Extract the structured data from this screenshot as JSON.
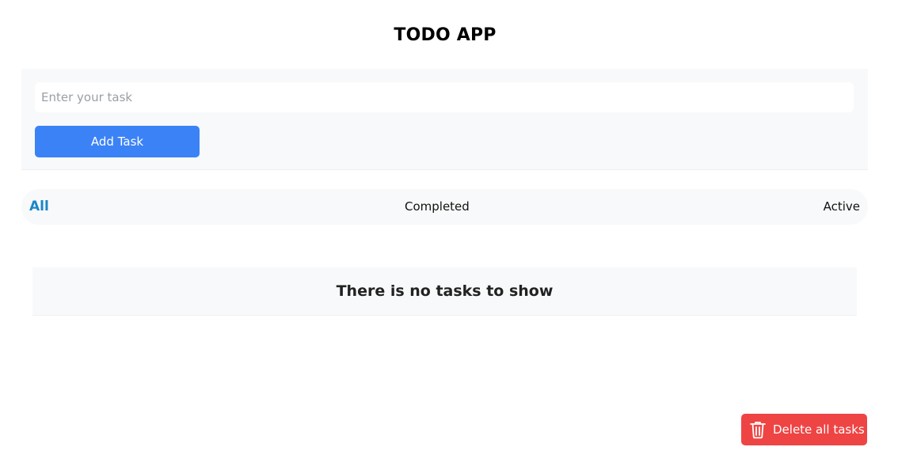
{
  "app": {
    "title": "TODO APP"
  },
  "form": {
    "task_input_value": "",
    "task_input_placeholder": "Enter your task",
    "add_button_label": "Add Task",
    "add_button_color": "#3b82f6"
  },
  "filters": {
    "tabs": [
      {
        "label": "All",
        "selected": true
      },
      {
        "label": "Completed",
        "selected": false
      },
      {
        "label": "Active",
        "selected": false
      }
    ],
    "selected_color": "#1a86c8"
  },
  "tasks": {
    "items": [],
    "empty_message": "There is no tasks to show"
  },
  "actions": {
    "delete_all_label": "Delete all tasks",
    "delete_all_icon": "trash-icon",
    "delete_all_color": "#ef4444"
  }
}
